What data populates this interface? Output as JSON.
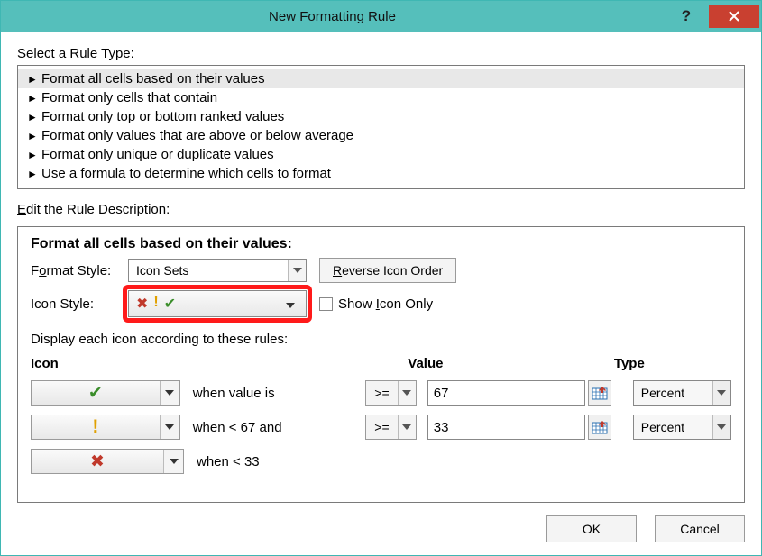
{
  "window": {
    "title": "New Formatting Rule",
    "help": "?",
    "close": "×"
  },
  "selectRuleTypeLabel": "Select a Rule Type:",
  "ruleTypes": [
    "Format all cells based on their values",
    "Format only cells that contain",
    "Format only top or bottom ranked values",
    "Format only values that are above or below average",
    "Format only unique or duplicate values",
    "Use a formula to determine which cells to format"
  ],
  "selectedRuleTypeIndex": 0,
  "editDescLabel": "Edit the Rule Description:",
  "descTitle": "Format all cells based on their values:",
  "formatStyle": {
    "label": "Format Style:",
    "value": "Icon Sets"
  },
  "reverseBtn": "Reverse Icon Order",
  "iconStyle": {
    "label": "Icon Style:"
  },
  "showIconOnly": {
    "label": "Show Icon Only",
    "checked": false
  },
  "displayRulesLabel": "Display each icon according to these rules:",
  "headers": {
    "icon": "Icon",
    "value": "Value",
    "type": "Type"
  },
  "rules": [
    {
      "icon": "check",
      "whenText": "when value is",
      "op": ">=",
      "value": "67",
      "type": "Percent"
    },
    {
      "icon": "excl",
      "whenText": "when < 67 and",
      "op": ">=",
      "value": "33",
      "type": "Percent"
    },
    {
      "icon": "cross",
      "whenText": "when < 33",
      "noInputs": true
    }
  ],
  "buttons": {
    "ok": "OK",
    "cancel": "Cancel"
  },
  "underlineLetters": {
    "select": "S",
    "edit": "E",
    "reverse": "R",
    "formatStyleO": "o",
    "showIconI": "I",
    "valueV": "V",
    "typeT": "T"
  }
}
